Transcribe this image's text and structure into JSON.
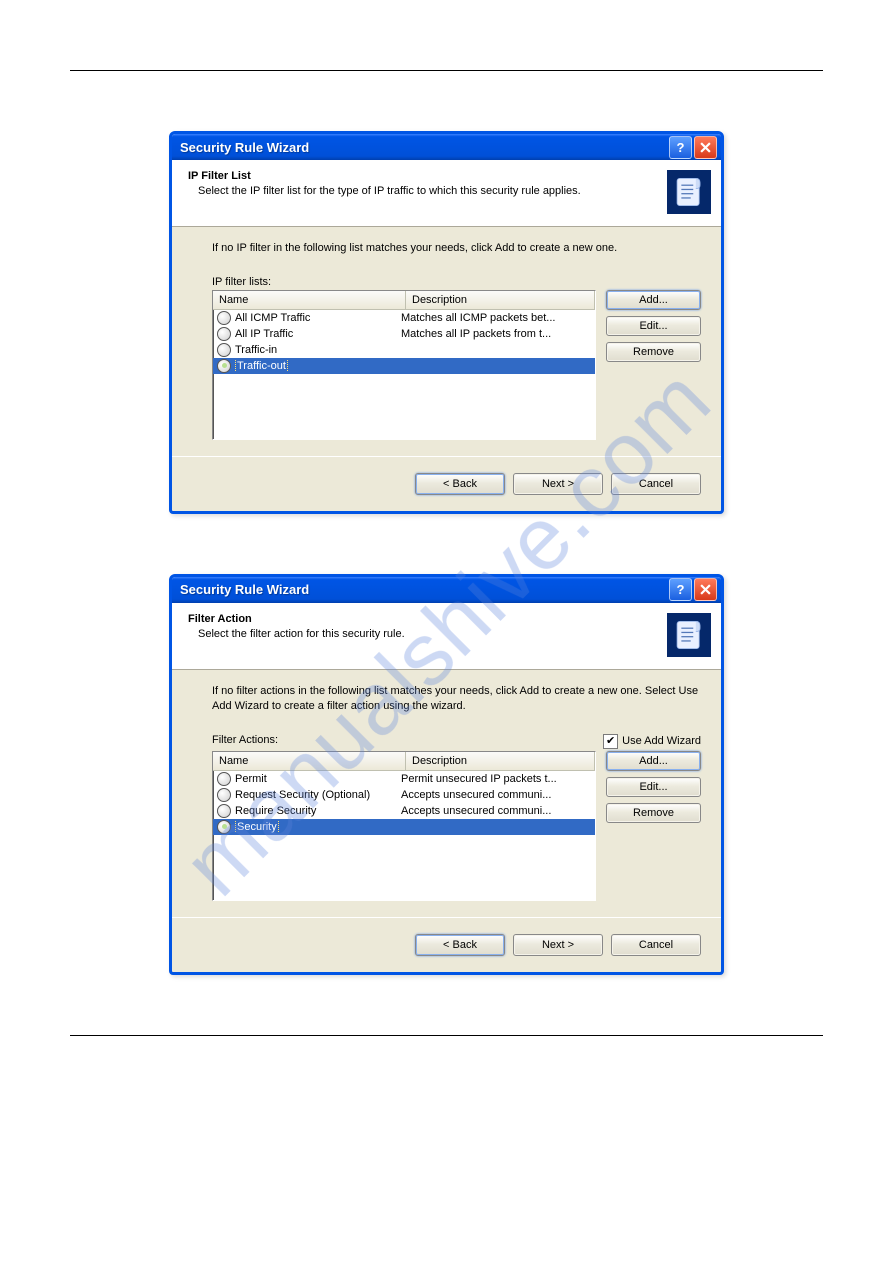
{
  "watermark": "manualshive.com",
  "dialogs": [
    {
      "title": "Security Rule Wizard",
      "header_title": "IP Filter List",
      "header_sub": "Select the IP filter list for the type of IP traffic to which this security rule applies.",
      "instruction": "If no IP filter in the following list matches your needs, click Add to create a new one.",
      "list_label": "IP filter lists:",
      "has_checkbox": false,
      "col_name": "Name",
      "col_desc": "Description",
      "rows": [
        {
          "name": "All ICMP Traffic",
          "desc": "Matches all ICMP packets bet...",
          "selected": false
        },
        {
          "name": "All IP Traffic",
          "desc": "Matches all IP packets from t...",
          "selected": false
        },
        {
          "name": "Traffic-in",
          "desc": "",
          "selected": false
        },
        {
          "name": "Traffic-out",
          "desc": "",
          "selected": true
        }
      ],
      "buttons": {
        "add": "Add...",
        "edit": "Edit...",
        "remove": "Remove"
      },
      "footer": {
        "back": "< Back",
        "next": "Next >",
        "cancel": "Cancel"
      }
    },
    {
      "title": "Security Rule Wizard",
      "header_title": "Filter Action",
      "header_sub": "Select the filter action for this security rule.",
      "instruction": "If no filter actions in the following list matches your needs, click Add to create a new one. Select Use Add Wizard to create a filter action using the wizard.",
      "list_label": "Filter Actions:",
      "has_checkbox": true,
      "checkbox_label": "Use Add Wizard",
      "col_name": "Name",
      "col_desc": "Description",
      "rows": [
        {
          "name": "Permit",
          "desc": "Permit unsecured IP packets t...",
          "selected": false
        },
        {
          "name": "Request Security (Optional)",
          "desc": "Accepts unsecured communi...",
          "selected": false
        },
        {
          "name": "Require Security",
          "desc": "Accepts unsecured communi...",
          "selected": false
        },
        {
          "name": "Security",
          "desc": "",
          "selected": true
        }
      ],
      "buttons": {
        "add": "Add...",
        "edit": "Edit...",
        "remove": "Remove"
      },
      "footer": {
        "back": "< Back",
        "next": "Next >",
        "cancel": "Cancel"
      }
    }
  ]
}
